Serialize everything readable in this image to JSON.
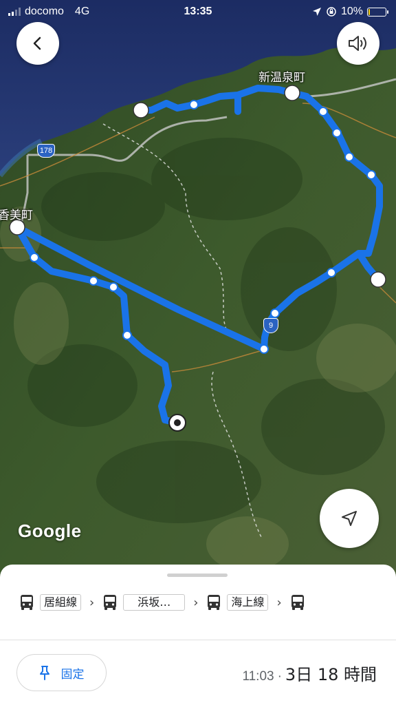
{
  "status_bar": {
    "carrier": "docomo",
    "network": "4G",
    "time": "13:35",
    "battery": "10%",
    "battery_level": 0.1
  },
  "map": {
    "attribution": "Google",
    "place_labels": [
      "新温泉町",
      "香美町"
    ],
    "route_shields": [
      "178",
      "9"
    ],
    "route_color": "#1a73e8"
  },
  "buttons": {
    "back_icon": "chevron-left-icon",
    "sound_icon": "speaker-icon",
    "locate_icon": "navigation-arrow-icon"
  },
  "bottom_sheet": {
    "steps": [
      {
        "icon": "bus-icon",
        "label": "居組線"
      },
      {
        "icon": "bus-icon",
        "label": "浜坂…"
      },
      {
        "icon": "bus-icon",
        "label": "海上線"
      },
      {
        "icon": "bus-icon",
        "label": ""
      }
    ],
    "pin_label": "固定",
    "eta_time": "11:03",
    "eta_separator": "·",
    "duration": "3日 18 時間"
  }
}
